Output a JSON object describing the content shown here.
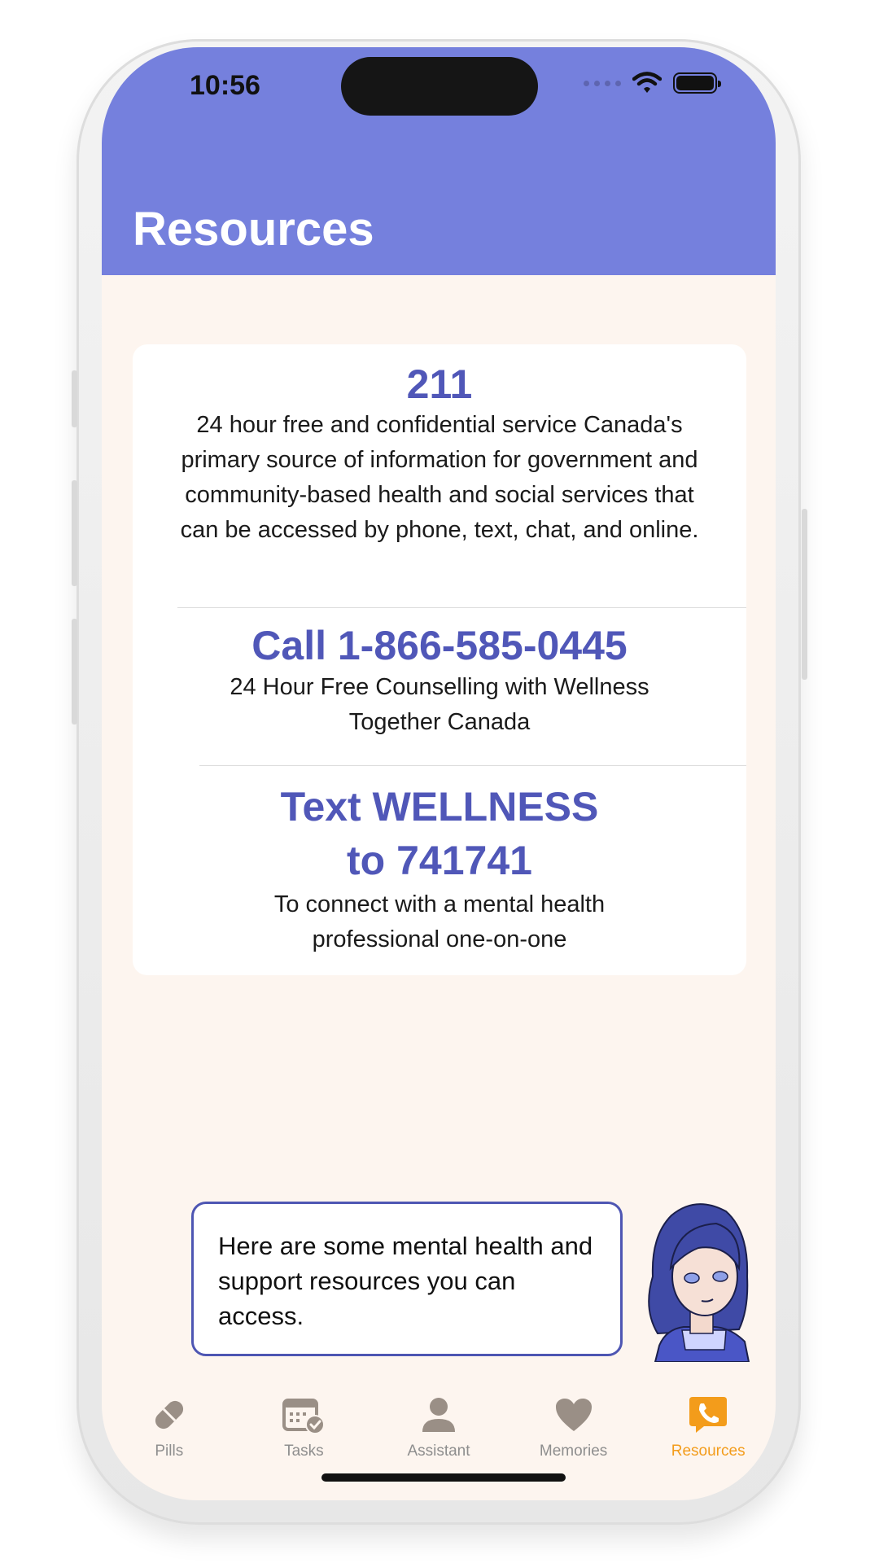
{
  "status": {
    "time": "10:56"
  },
  "header": {
    "title": "Resources"
  },
  "resources": [
    {
      "heading": "211",
      "description": "24 hour free and confidential service Canada's primary source of information for government and community-based health and social services that can be accessed by phone, text, chat, and online."
    },
    {
      "heading": "Call 1-866-585-0445",
      "description": "24 Hour Free Counselling with Wellness Together Canada"
    },
    {
      "heading_line1": "Text WELLNESS",
      "heading_line2": "to 741741",
      "description": "To connect with a mental health professional one-on-one"
    }
  ],
  "assistant": {
    "message": "Here are some mental health and support resources you can access."
  },
  "tabs": [
    {
      "label": "Pills",
      "icon": "pill-icon",
      "active": false
    },
    {
      "label": "Tasks",
      "icon": "calendar-check-icon",
      "active": false
    },
    {
      "label": "Assistant",
      "icon": "person-icon",
      "active": false
    },
    {
      "label": "Memories",
      "icon": "heart-icon",
      "active": false
    },
    {
      "label": "Resources",
      "icon": "phone-bubble-icon",
      "active": true
    }
  ],
  "colors": {
    "header": "#7580dd",
    "accent": "#5057b8",
    "active_tab": "#f39c1b",
    "background": "#fdf5ef"
  }
}
